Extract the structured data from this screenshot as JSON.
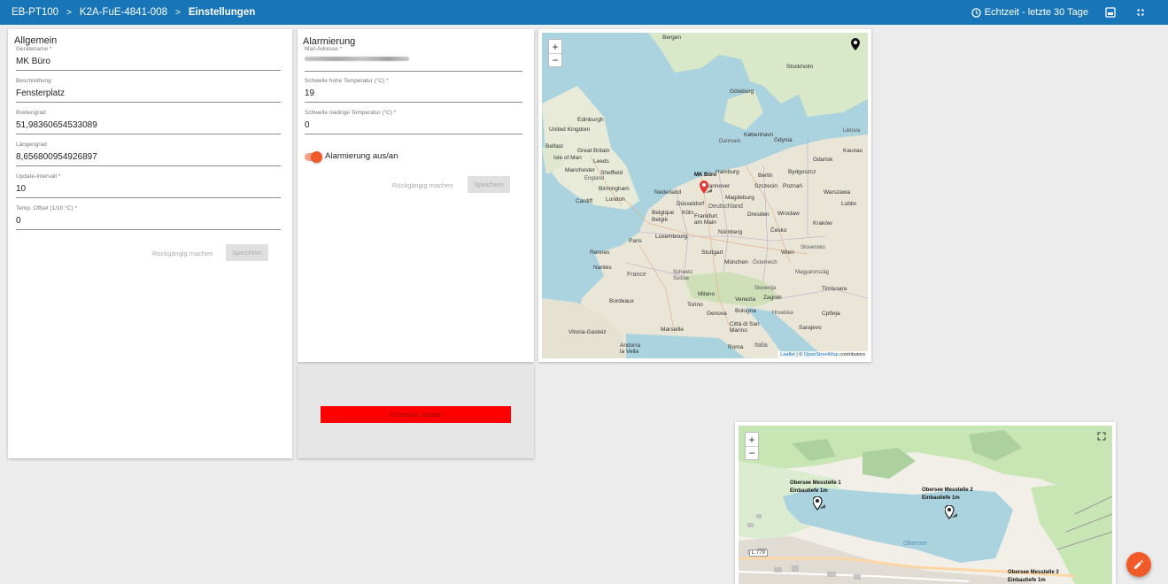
{
  "breadcrumb": {
    "items": [
      "EB-PT100",
      "K2A-FuE-4841-008",
      "Einstellungen"
    ],
    "separator": ">"
  },
  "header": {
    "realtime_label": "Echtzeit - letzte 30 Tage",
    "icons": [
      "clock-icon",
      "screenshot-icon",
      "fullscreen-icon"
    ]
  },
  "allgemein": {
    "title": "Allgemein",
    "fields": [
      {
        "label": "Gerätename *",
        "value": "MK Büro"
      },
      {
        "label": "Beschreibung",
        "value": "Fensterplatz"
      },
      {
        "label": "Breitengrad",
        "value": "51,98360654533089"
      },
      {
        "label": "Längengrad",
        "value": "8,656800954926897"
      },
      {
        "label": "Update-Intervall *",
        "value": "10"
      },
      {
        "label": "Temp. Offset (1/10 °C) *",
        "value": "0"
      }
    ],
    "undo_label": "Rückgängig machen",
    "save_label": "Speichern"
  },
  "alarmierung": {
    "title": "Alarmierung",
    "fields": [
      {
        "label": "Mail-Adresse *",
        "value": ""
      },
      {
        "label": "Schwelle hohe Temperatur (°C) *",
        "value": "19"
      },
      {
        "label": "Schwelle niedrige Temperatur (°C) *",
        "value": "0"
      }
    ],
    "toggle_label": "Alarmierung aus/an",
    "toggle_on": true,
    "undo_label": "Rückgängig machen",
    "save_label": "Speichern"
  },
  "firmware": {
    "button_label": "Firmware Update"
  },
  "map_europe": {
    "zoom_in": "+",
    "zoom_out": "−",
    "marker_label": "MK Büro",
    "cities": [
      "Bergen",
      "Stockholm",
      "Göteborg",
      "Edinburgh",
      "United Kingdom",
      "Great Britain",
      "Isle of Man",
      "Belfast",
      "Leeds",
      "Manchester",
      "Sheffield",
      "England",
      "Birmingham",
      "London",
      "Cardiff",
      "Nederland",
      "Hamburg",
      "Berlin",
      "Bydgoszcz",
      "Gdańsk",
      "Poznań",
      "Warszawa",
      "Szczecin",
      "Düsseldorf",
      "Magdeburg",
      "Deutschland",
      "Belgique",
      "België",
      "Frankfurt am Main",
      "Dresden",
      "Wrocław",
      "Kraków",
      "Lublin",
      "Paris",
      "Luxembourg",
      "Nürnberg",
      "Česko",
      "Rennes",
      "Nantes",
      "France",
      "Stuttgart",
      "München",
      "Österreich",
      "Wien",
      "Slovensko",
      "Magyarország",
      "Suisse",
      "Schweiz",
      "Slovenija",
      "Hrvatska",
      "Torino",
      "Genova",
      "Bologna",
      "Venezia",
      "Marseille",
      "Italia",
      "Roma",
      "Città di San Marino",
      "Timișoara",
      "Србија",
      "København",
      "Danmark",
      "Lietuva",
      "Vitoria-Gasteiz",
      "Andorra la Vella",
      "Kaunas",
      "Bordeaux",
      "Milano",
      "Zagreb",
      "Sarajevo",
      "Gdynia",
      "Köln",
      "Hannover"
    ],
    "attribution_leaflet": "Leaflet",
    "attribution_osm": "OpenStreetMap",
    "attribution_suffix": "contributors"
  },
  "map_local": {
    "zoom_in": "+",
    "zoom_out": "−",
    "markers": [
      {
        "name": "Obersee Messtelle 1",
        "sub": "Einbautiefe 1m"
      },
      {
        "name": "Obersee Messtelle 2",
        "sub": "Einbautiefe 1m"
      },
      {
        "name": "Obersee Messtelle 3",
        "sub": "Einbautiefe 1m"
      }
    ],
    "lake_label": "Obersee",
    "road_label": "L 779"
  },
  "colors": {
    "topbar": "#1775b8",
    "accent": "#f05a28",
    "firmware_button": "#ff0000",
    "water": "#aad3df",
    "land": "#f2efe9",
    "green": "#c8e6b4"
  }
}
